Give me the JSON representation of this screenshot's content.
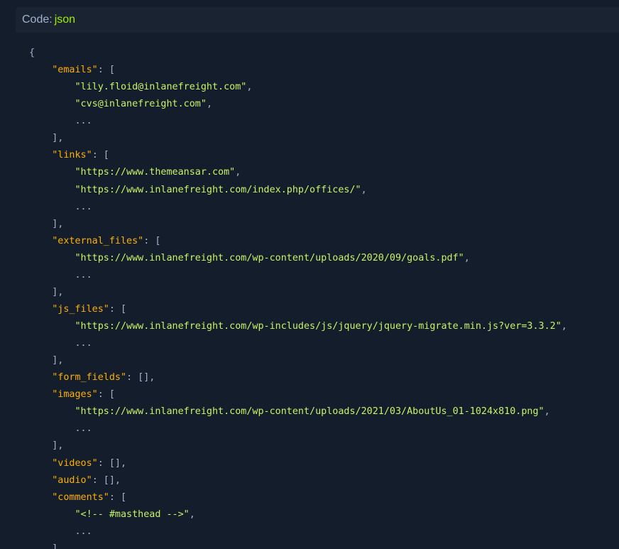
{
  "header": {
    "label": "Code:",
    "language": "json"
  },
  "code": {
    "lines": [
      [
        {
          "t": "p",
          "v": "{"
        }
      ],
      [
        {
          "t": "p",
          "v": "    "
        },
        {
          "t": "k",
          "v": "\"emails\""
        },
        {
          "t": "p",
          "v": ": ["
        }
      ],
      [
        {
          "t": "p",
          "v": "        "
        },
        {
          "t": "s",
          "v": "\"lily.floid@inlanefreight.com\""
        },
        {
          "t": "p",
          "v": ","
        }
      ],
      [
        {
          "t": "p",
          "v": "        "
        },
        {
          "t": "s",
          "v": "\"cvs@inlanefreight.com\""
        },
        {
          "t": "p",
          "v": ","
        }
      ],
      [
        {
          "t": "p",
          "v": "        ..."
        }
      ],
      [
        {
          "t": "p",
          "v": "    ],"
        }
      ],
      [
        {
          "t": "p",
          "v": "    "
        },
        {
          "t": "k",
          "v": "\"links\""
        },
        {
          "t": "p",
          "v": ": ["
        }
      ],
      [
        {
          "t": "p",
          "v": "        "
        },
        {
          "t": "s",
          "v": "\"https://www.themeansar.com\""
        },
        {
          "t": "p",
          "v": ","
        }
      ],
      [
        {
          "t": "p",
          "v": "        "
        },
        {
          "t": "s",
          "v": "\"https://www.inlanefreight.com/index.php/offices/\""
        },
        {
          "t": "p",
          "v": ","
        }
      ],
      [
        {
          "t": "p",
          "v": "        ..."
        }
      ],
      [
        {
          "t": "p",
          "v": "    ],"
        }
      ],
      [
        {
          "t": "p",
          "v": "    "
        },
        {
          "t": "k",
          "v": "\"external_files\""
        },
        {
          "t": "p",
          "v": ": ["
        }
      ],
      [
        {
          "t": "p",
          "v": "        "
        },
        {
          "t": "s",
          "v": "\"https://www.inlanefreight.com/wp-content/uploads/2020/09/goals.pdf\""
        },
        {
          "t": "p",
          "v": ","
        }
      ],
      [
        {
          "t": "p",
          "v": "        ..."
        }
      ],
      [
        {
          "t": "p",
          "v": "    ],"
        }
      ],
      [
        {
          "t": "p",
          "v": "    "
        },
        {
          "t": "k",
          "v": "\"js_files\""
        },
        {
          "t": "p",
          "v": ": ["
        }
      ],
      [
        {
          "t": "p",
          "v": "        "
        },
        {
          "t": "s",
          "v": "\"https://www.inlanefreight.com/wp-includes/js/jquery/jquery-migrate.min.js?ver=3.3.2\""
        },
        {
          "t": "p",
          "v": ","
        }
      ],
      [
        {
          "t": "p",
          "v": "        ..."
        }
      ],
      [
        {
          "t": "p",
          "v": "    ],"
        }
      ],
      [
        {
          "t": "p",
          "v": "    "
        },
        {
          "t": "k",
          "v": "\"form_fields\""
        },
        {
          "t": "p",
          "v": ": [],"
        }
      ],
      [
        {
          "t": "p",
          "v": "    "
        },
        {
          "t": "k",
          "v": "\"images\""
        },
        {
          "t": "p",
          "v": ": ["
        }
      ],
      [
        {
          "t": "p",
          "v": "        "
        },
        {
          "t": "s",
          "v": "\"https://www.inlanefreight.com/wp-content/uploads/2021/03/AboutUs_01-1024x810.png\""
        },
        {
          "t": "p",
          "v": ","
        }
      ],
      [
        {
          "t": "p",
          "v": "        ..."
        }
      ],
      [
        {
          "t": "p",
          "v": "    ],"
        }
      ],
      [
        {
          "t": "p",
          "v": "    "
        },
        {
          "t": "k",
          "v": "\"videos\""
        },
        {
          "t": "p",
          "v": ": [],"
        }
      ],
      [
        {
          "t": "p",
          "v": "    "
        },
        {
          "t": "k",
          "v": "\"audio\""
        },
        {
          "t": "p",
          "v": ": [],"
        }
      ],
      [
        {
          "t": "p",
          "v": "    "
        },
        {
          "t": "k",
          "v": "\"comments\""
        },
        {
          "t": "p",
          "v": ": ["
        }
      ],
      [
        {
          "t": "p",
          "v": "        "
        },
        {
          "t": "s",
          "v": "\"<!-- #masthead -->\""
        },
        {
          "t": "p",
          "v": ","
        }
      ],
      [
        {
          "t": "p",
          "v": "        ..."
        }
      ],
      [
        {
          "t": "p",
          "v": "    ]"
        }
      ]
    ]
  },
  "colors": {
    "page_background": "#141d2b",
    "header_background": "#1a2332",
    "key": "#ffaf00",
    "string": "#c5f467",
    "punctuation": "#a4b1cd",
    "language_accent": "#9fef00"
  }
}
